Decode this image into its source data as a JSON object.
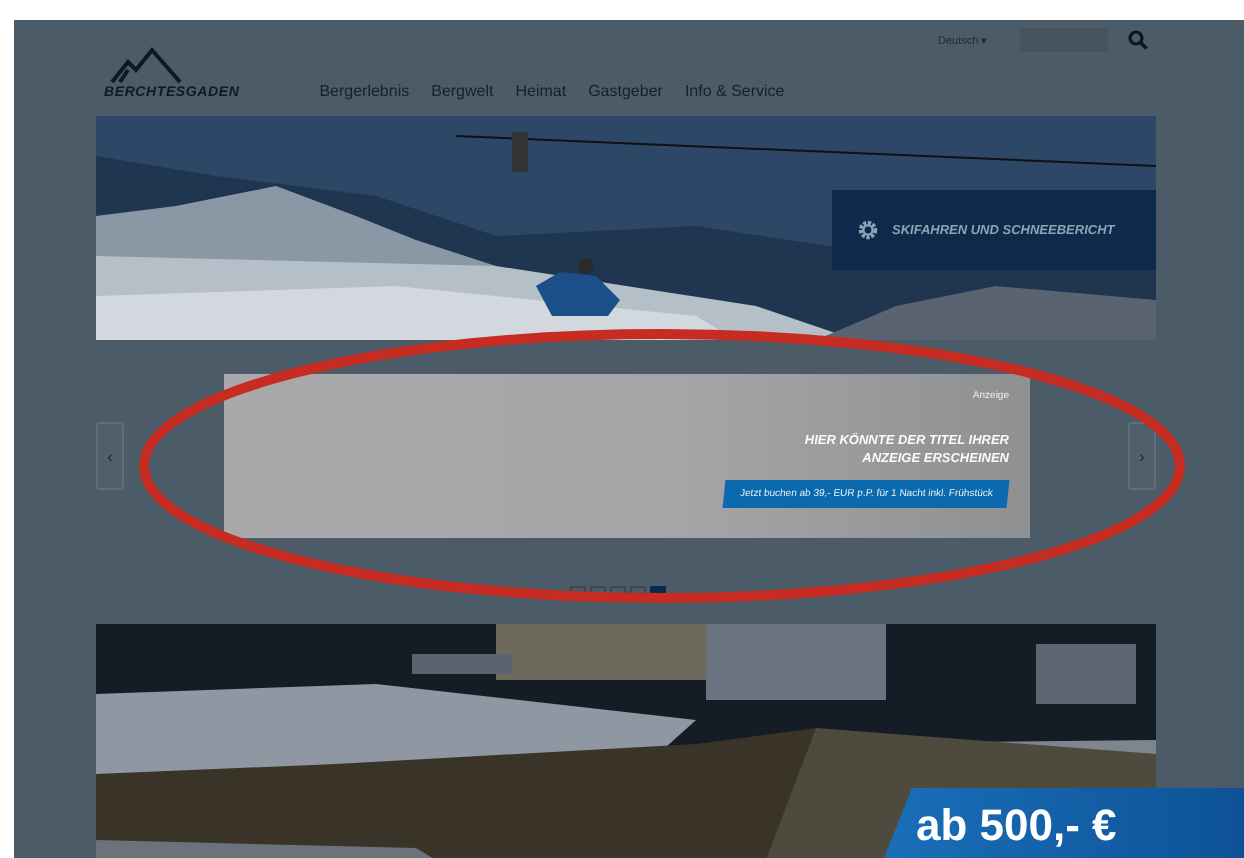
{
  "header": {
    "logo": "BERCHTESGADEN",
    "nav": [
      "Bergerlebnis",
      "Bergwelt",
      "Heimat",
      "Gastgeber",
      "Info & Service"
    ],
    "language": "Deutsch ▾"
  },
  "hero": {
    "tag": "SKIFAHREN UND SCHNEEBERICHT"
  },
  "ad": {
    "label": "Anzeige",
    "title_lines": [
      "HIER KÖNNTE DER TITEL IHRER",
      "ANZEIGE ERSCHEINEN"
    ],
    "button": "Jetzt buchen ab 39,- EUR p.P. für 1 Nacht inkl. Frühstück"
  },
  "carousel": {
    "prev": "‹",
    "next": "›",
    "dots": [
      {
        "selected": false
      },
      {
        "selected": false
      },
      {
        "selected": false
      },
      {
        "selected": false
      },
      {
        "selected": true
      }
    ]
  },
  "teaser": {
    "price": "ab 500,- €"
  }
}
